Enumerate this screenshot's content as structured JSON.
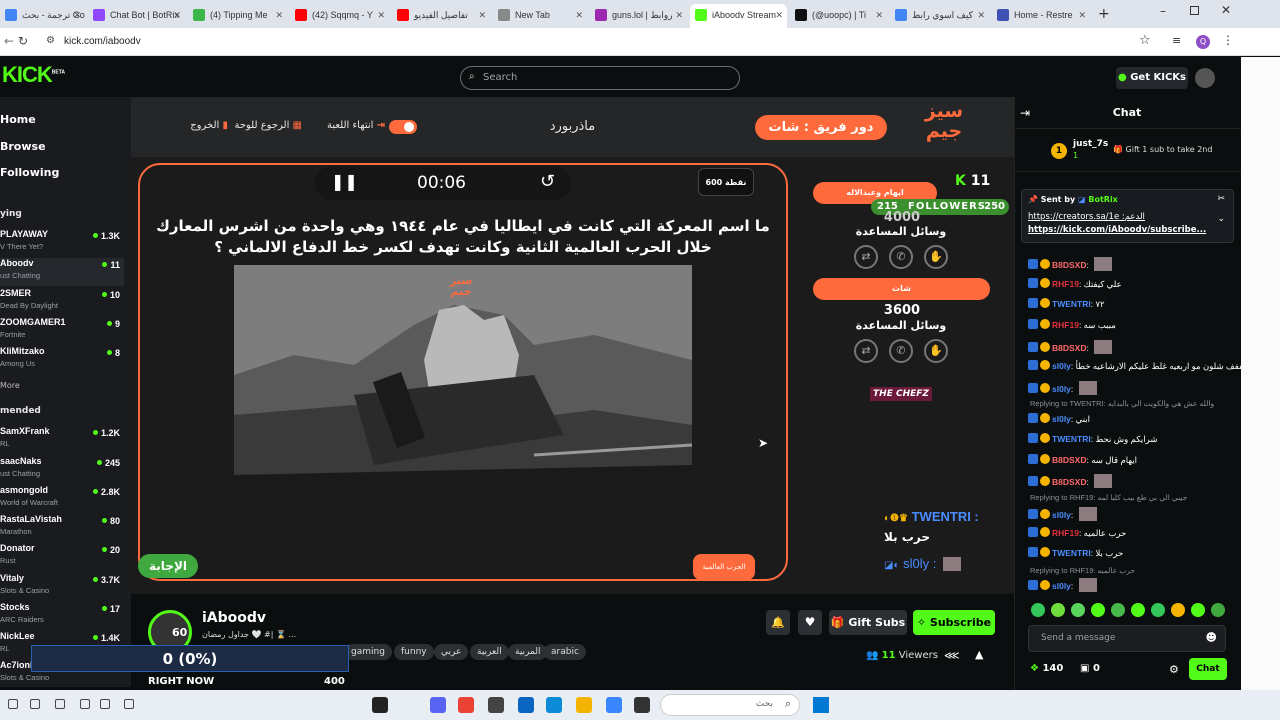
{
  "browser": {
    "tabs": [
      {
        "label": "ترجمة - بحث Google",
        "fav": "#4285f4"
      },
      {
        "label": "Chat Bot | BotRix",
        "fav": "#9146ff"
      },
      {
        "label": "(4) Tipping Me",
        "fav": "#3bb54a"
      },
      {
        "label": "(42) Sqqmq - Y",
        "fav": "#ff0000"
      },
      {
        "label": "تفاصيل الفيديو",
        "fav": "#ff0000"
      },
      {
        "label": "New Tab",
        "fav": "#888888"
      },
      {
        "label": "guns.lol | روابط",
        "fav": "#9c27b0"
      },
      {
        "label": "iAboodv Stream",
        "fav": "#53fc18"
      },
      {
        "label": "(@uoopc) | Ti",
        "fav": "#111111"
      },
      {
        "label": "كيف اسوي رابط",
        "fav": "#4285f4"
      },
      {
        "label": "Home - Restre",
        "fav": "#3f51b5"
      }
    ],
    "url": "kick.com/iaboodv"
  },
  "header": {
    "logo": "KICK",
    "beta": "BETA",
    "search_placeholder": "Search",
    "get_kicks": "Get KICKs"
  },
  "sidebar": {
    "nav": [
      "Home",
      "Browse",
      "Following"
    ],
    "following_title": "ying",
    "following": [
      {
        "name": "PLAYAWAY",
        "cat": "V There Yet?",
        "viewers": "1.3K"
      },
      {
        "name": "Aboodv",
        "cat": "ust Chatting",
        "viewers": "11"
      },
      {
        "name": "2SMER",
        "cat": "Dead By Daylight",
        "viewers": "10"
      },
      {
        "name": "ZOOMGAMER1",
        "cat": "Fortnite",
        "viewers": "9"
      },
      {
        "name": "KliMitzako",
        "cat": "Among Us",
        "viewers": "8"
      }
    ],
    "more": "More",
    "recommended_title": "mended",
    "recommended": [
      {
        "name": "SamXFrank",
        "cat": "RL",
        "viewers": "1.2K"
      },
      {
        "name": "saacNaks",
        "cat": "ust Chatting",
        "viewers": "245"
      },
      {
        "name": "asmongold",
        "cat": "World of Warcraft",
        "viewers": "2.8K"
      },
      {
        "name": "RastaLaVistah",
        "cat": "Marathon",
        "viewers": "80"
      },
      {
        "name": "Donator",
        "cat": "Rust",
        "viewers": "20"
      },
      {
        "name": "Vitaly",
        "cat": "Slots & Casino",
        "viewers": "3.7K"
      },
      {
        "name": "Stocks",
        "cat": "ARC Raiders",
        "viewers": "17"
      },
      {
        "name": "NickLee",
        "cat": "RL",
        "viewers": "1.4K"
      },
      {
        "name": "Ac7ionMan",
        "cat": "Slots & Casino",
        "viewers": ""
      }
    ]
  },
  "game": {
    "brand_line1": "سيز",
    "brand_line2": "جيم",
    "team_turn": "دور فريق : شات",
    "mode": "ماذربورد",
    "end_game": "انتهاء اللعبة",
    "back_board": "الرجوع للوحة",
    "exit": "الخروج",
    "timer": "00:06",
    "points": "600 نقطة",
    "question": "ما اسم المعركة التي كانت في ايطاليا في عام ١٩٤٤ وهي واحدة من اشرس المعارك خلال الحرب العالمية الثانية وكانت تهدف لكسر خط الدفاع الالماني ؟",
    "answer_btn": "الإجابة",
    "answer_label": "الحرب العالمية",
    "team1_name": "ايهام وعبدالاله",
    "team1_score": "4000",
    "helpers_label": "وسائل المساعدة",
    "team2_name": "شات",
    "team2_score": "3600",
    "chefz": "THE CHEFZ",
    "overlay_count": "11",
    "followers_left": "215",
    "followers_label": "FOLLOWERS",
    "followers_right": "250",
    "feed_user1": "TWENTRI :",
    "feed_msg1": "حرب بلا",
    "feed_user2": "sl0ly :"
  },
  "channel": {
    "name": "iAboodv",
    "level": "60",
    "title": "جداول رمضان 🤍 #| ⌛ ...",
    "tags": [
      "gaming",
      "funny",
      "عربي",
      "العربية",
      "المربية",
      "arabic"
    ],
    "gift_subs": "Gift Subs",
    "subscribe": "Subscribe",
    "viewers_count": "11",
    "viewers_label": "Viewers",
    "goal_value": "0 (0%)",
    "right_now": "RIGHT NOW",
    "goal_target": "400"
  },
  "chat": {
    "title": "Chat",
    "pinned_user": "just_7s",
    "pinned_rank": "1",
    "pinned_action": "Gift 1 sub to take 2nd",
    "pin_sent_by": "Sent by",
    "pin_bot": "BotRix",
    "pin_link1": "https://creators.sa/1e :الدعم",
    "pin_link2": "https://kick.com/iAboodv/subscribe...",
    "messages": [
      {
        "type": "msg",
        "user": "B8DSXD",
        "color": "#ff6a6a",
        "text": "",
        "avatar": true
      },
      {
        "type": "msg",
        "user": "RHF19",
        "color": "#e0323c",
        "text": "علي كيفتك"
      },
      {
        "type": "msg",
        "user": "TWENTRI",
        "color": "#4a8cff",
        "text": "٧٢"
      },
      {
        "type": "msg",
        "user": "RHF19",
        "color": "#e0323c",
        "text": "مببب سه"
      },
      {
        "type": "msg",
        "user": "B8DSXD",
        "color": "#ff6a6a",
        "text": "",
        "avatar": true
      },
      {
        "type": "msg",
        "user": "sl0ly",
        "color": "#4a8cff",
        "text": "فففف شلون مو اربعيه غلط عليكم الارشاعيه خطأ"
      },
      {
        "type": "msg",
        "user": "sl0ly",
        "color": "#4a8cff",
        "text": "",
        "avatar": true
      },
      {
        "type": "reply",
        "text": "Replying to TWENTRI: والله عش هي والكويت الي بالبدايه"
      },
      {
        "type": "msg",
        "user": "sl0ly",
        "color": "#4a8cff",
        "text": "ابني"
      },
      {
        "type": "msg",
        "user": "TWENTRI",
        "color": "#4a8cff",
        "text": "شرايكم وش نحط"
      },
      {
        "type": "msg",
        "user": "B8DSXD",
        "color": "#ff6a6a",
        "text": "ايهام قال سه"
      },
      {
        "type": "msg",
        "user": "B8DSXD",
        "color": "#ff6a6a",
        "text": "",
        "avatar": true
      },
      {
        "type": "reply",
        "text": "Replying to RHF19: جيبي الي بي طع بيب كليا لمه"
      },
      {
        "type": "msg",
        "user": "sl0ly",
        "color": "#4a8cff",
        "text": "",
        "avatar": true
      },
      {
        "type": "msg",
        "user": "RHF19",
        "color": "#e0323c",
        "text": "حرب عالميه"
      },
      {
        "type": "msg",
        "user": "TWENTRI",
        "color": "#4a8cff",
        "text": "حرب بلا"
      },
      {
        "type": "reply",
        "text": "Replying to RHF19: حرب عالميه"
      },
      {
        "type": "msg",
        "user": "sl0ly",
        "color": "#4a8cff",
        "text": "",
        "avatar": true
      }
    ],
    "input_placeholder": "Send a message",
    "kicks_count": "140",
    "points_count": "0",
    "chat_btn": "Chat"
  },
  "taskbar": {
    "search_placeholder": "بحث"
  }
}
